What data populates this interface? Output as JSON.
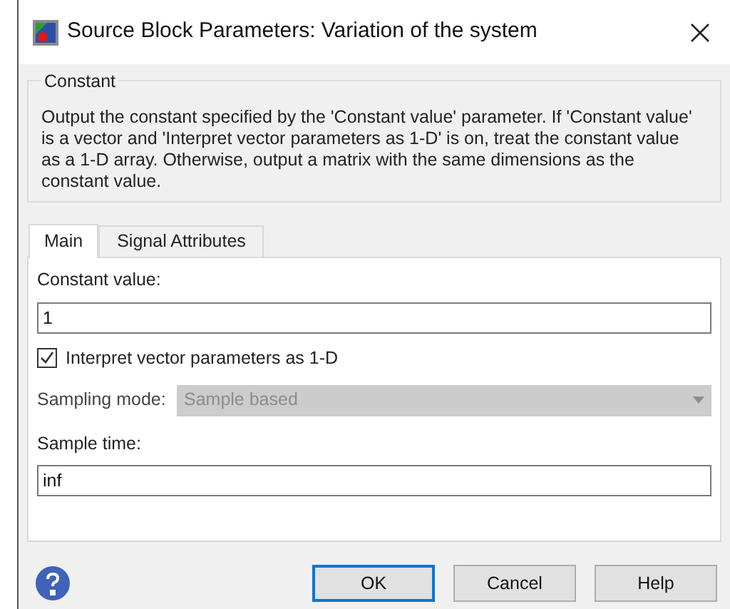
{
  "window": {
    "title": "Source Block Parameters: Variation of the system"
  },
  "group": {
    "title": "Constant",
    "description": "Output the constant specified by the 'Constant value' parameter. If 'Constant value' is a vector and 'Interpret vector parameters as 1-D' is on, treat the constant value as a 1-D array. Otherwise, output a matrix with the same dimensions as the constant value."
  },
  "tabs": [
    {
      "label": "Main",
      "selected": true
    },
    {
      "label": "Signal Attributes",
      "selected": false
    }
  ],
  "constant_value": {
    "label": "Constant value:",
    "value": "1"
  },
  "interpret_checkbox": {
    "label": "Interpret vector parameters as 1-D",
    "checked": true
  },
  "sampling_mode": {
    "label": "Sampling mode:",
    "value": "Sample based",
    "disabled": true
  },
  "sample_time": {
    "label": "Sample time:",
    "value": "inf"
  },
  "buttons": [
    {
      "label": "OK",
      "focused": true
    },
    {
      "label": "Cancel",
      "focused": false
    },
    {
      "label": "Help",
      "focused": false
    }
  ]
}
